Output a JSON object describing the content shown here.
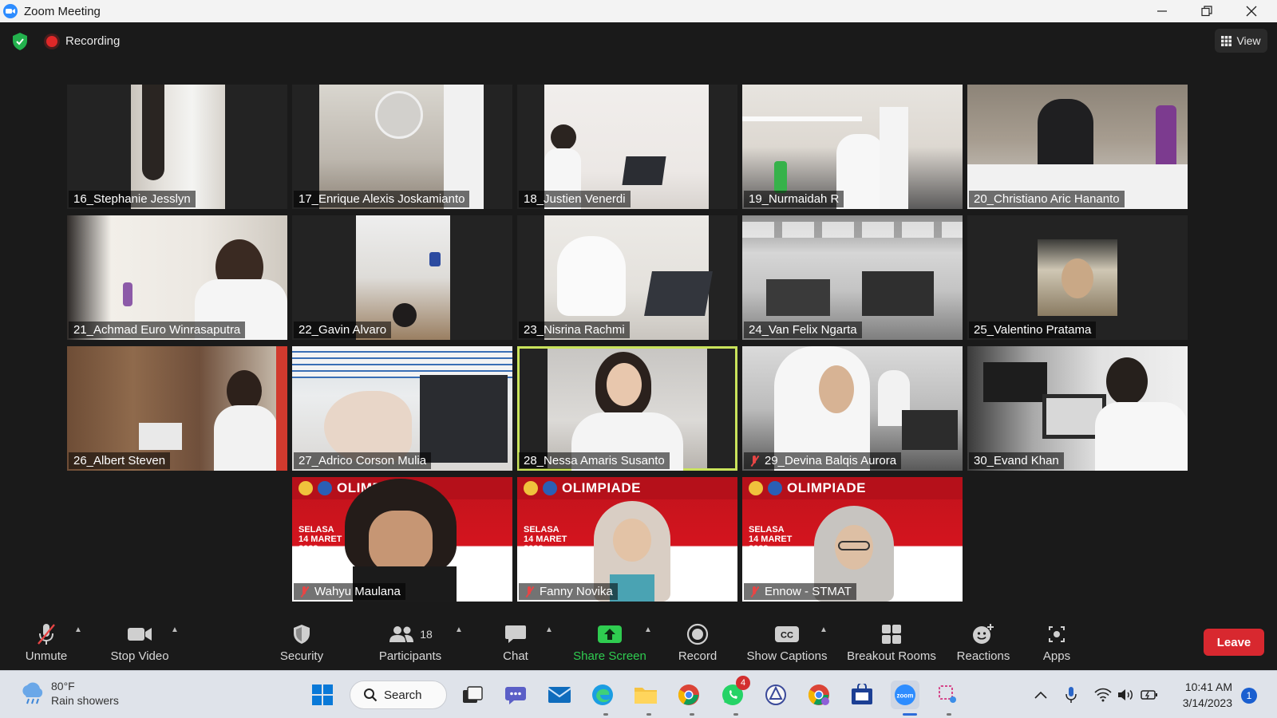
{
  "window": {
    "title": "Zoom Meeting"
  },
  "topbar": {
    "recording_label": "Recording",
    "view_label": "View"
  },
  "participants_grid": [
    {
      "name": "16_Stephanie Jesslyn",
      "muted": false
    },
    {
      "name": "17_Enrique Alexis Joskamianto",
      "muted": false
    },
    {
      "name": "18_Justien Venerdi",
      "muted": false
    },
    {
      "name": "19_Nurmaidah R",
      "muted": false
    },
    {
      "name": "20_Christiano Aric Hananto",
      "muted": false
    },
    {
      "name": "21_Achmad Euro Winrasaputra",
      "muted": false
    },
    {
      "name": "22_Gavin Alvaro",
      "muted": false
    },
    {
      "name": "23_Nisrina Rachmi",
      "muted": false
    },
    {
      "name": "24_Van Felix Ngarta",
      "muted": false
    },
    {
      "name": "25_Valentino Pratama",
      "muted": false
    },
    {
      "name": "26_Albert Steven",
      "muted": false
    },
    {
      "name": "27_Adrico Corson Mulia",
      "muted": false
    },
    {
      "name": "28_Nessa Amaris Susanto",
      "muted": false,
      "active": true
    },
    {
      "name": "29_Devina Balqis Aurora",
      "muted": true
    },
    {
      "name": "30_Evand Khan",
      "muted": false
    }
  ],
  "host_row": [
    {
      "name": "Wahyu Maulana",
      "muted": true
    },
    {
      "name": "Fanny Novika",
      "muted": true
    },
    {
      "name": "Ennow - STMAT",
      "muted": true
    }
  ],
  "banner": {
    "title": "OLIMPIADE",
    "date_lines": [
      "SELASA",
      "14 MARET",
      "2023"
    ]
  },
  "toolbar": {
    "unmute": "Unmute",
    "stop_video": "Stop Video",
    "security": "Security",
    "participants": "Participants",
    "participants_count": "18",
    "chat": "Chat",
    "share_screen": "Share Screen",
    "record": "Record",
    "show_captions": "Show Captions",
    "breakout_rooms": "Breakout Rooms",
    "reactions": "Reactions",
    "apps": "Apps",
    "leave": "Leave"
  },
  "taskbar": {
    "weather_temp": "80°F",
    "weather_desc": "Rain showers",
    "search_label": "Search",
    "whatsapp_badge": "4",
    "time": "10:41 AM",
    "date": "3/14/2023",
    "notification_count": "1"
  },
  "colors": {
    "zoom_blue": "#2d8cff",
    "leave_red": "#d8282f",
    "share_green": "#2fcc50",
    "active_speaker": "#c9e35b"
  }
}
